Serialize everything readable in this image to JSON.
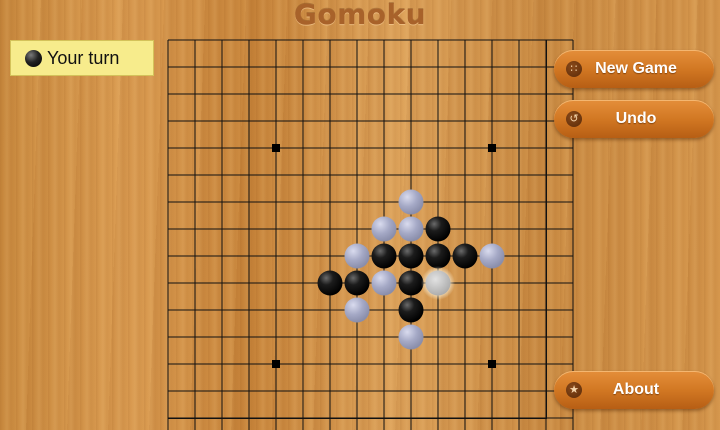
{
  "app": {
    "title": "Gomoku"
  },
  "status": {
    "text": "Your turn",
    "player_icon": "black-stone-icon"
  },
  "buttons": {
    "new_game": {
      "label": "New Game",
      "icon": "grid-icon"
    },
    "undo": {
      "label": "Undo",
      "icon": "undo-arrow-icon"
    },
    "about": {
      "label": "About",
      "icon": "star-icon"
    }
  },
  "board": {
    "size": 15,
    "star_points": [
      [
        3,
        3
      ],
      [
        11,
        3
      ],
      [
        3,
        11
      ],
      [
        11,
        11
      ]
    ],
    "colors": {
      "black": "#111111",
      "white": "#a8acc8",
      "highlight": "#c8c8c8",
      "line": "#111111"
    },
    "stones": [
      {
        "col": 8,
        "row": 5,
        "color": "white"
      },
      {
        "col": 7,
        "row": 6,
        "color": "white"
      },
      {
        "col": 8,
        "row": 6,
        "color": "white"
      },
      {
        "col": 9,
        "row": 6,
        "color": "black"
      },
      {
        "col": 6,
        "row": 7,
        "color": "white"
      },
      {
        "col": 7,
        "row": 7,
        "color": "black"
      },
      {
        "col": 8,
        "row": 7,
        "color": "black"
      },
      {
        "col": 9,
        "row": 7,
        "color": "black"
      },
      {
        "col": 10,
        "row": 7,
        "color": "black"
      },
      {
        "col": 11,
        "row": 7,
        "color": "white"
      },
      {
        "col": 5,
        "row": 8,
        "color": "black"
      },
      {
        "col": 6,
        "row": 8,
        "color": "black"
      },
      {
        "col": 7,
        "row": 8,
        "color": "white"
      },
      {
        "col": 8,
        "row": 8,
        "color": "black"
      },
      {
        "col": 9,
        "row": 8,
        "color": "white",
        "last_move": true
      },
      {
        "col": 6,
        "row": 9,
        "color": "white"
      },
      {
        "col": 8,
        "row": 9,
        "color": "black"
      },
      {
        "col": 8,
        "row": 10,
        "color": "white"
      }
    ]
  }
}
